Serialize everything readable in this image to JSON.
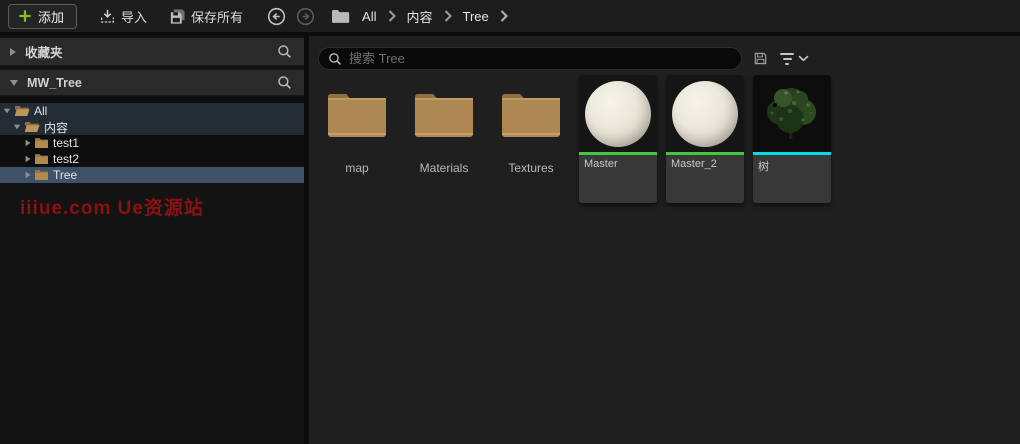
{
  "toolbar": {
    "add_label": "添加",
    "import_label": "导入",
    "save_all_label": "保存所有",
    "breadcrumb": [
      "All",
      "内容",
      "Tree"
    ]
  },
  "left_panel": {
    "favorites_header": "收藏夹",
    "collection_header": "MW_Tree",
    "tree": [
      {
        "label": "All",
        "level": 0,
        "expanded": true,
        "folder": "open",
        "selected": false
      },
      {
        "label": "内容",
        "level": 1,
        "expanded": true,
        "folder": "open",
        "selected": false
      },
      {
        "label": "test1",
        "level": 2,
        "expanded": false,
        "folder": "closed",
        "selected": false
      },
      {
        "label": "test2",
        "level": 2,
        "expanded": false,
        "folder": "closed",
        "selected": false
      },
      {
        "label": "Tree",
        "level": 2,
        "expanded": false,
        "folder": "closed",
        "selected": true
      }
    ],
    "watermark": "iiiue.com Ue资源站"
  },
  "main": {
    "search_placeholder": "搜索 Tree",
    "folders": [
      {
        "name": "map"
      },
      {
        "name": "Materials"
      },
      {
        "name": "Textures"
      }
    ],
    "assets": [
      {
        "name": "Master",
        "type": "material",
        "stripe_color": "#3fc93f"
      },
      {
        "name": "Master_2",
        "type": "material",
        "stripe_color": "#3fc93f"
      },
      {
        "name": "树",
        "type": "static_mesh",
        "stripe_color": "#00dce8"
      }
    ]
  },
  "icons": {
    "add": "plus-icon",
    "import": "import-tray-icon",
    "save_all": "save-all-floppy-icon",
    "back": "circle-arrow-left-icon",
    "forward": "circle-arrow-right-icon",
    "breadcrumb_folder": "folder-icon",
    "breadcrumb_separator": "chevron-right-icon",
    "header_search": "magnifier-icon",
    "searchbar_save": "floppy-icon",
    "filter": "filter-lines-icon",
    "filter_caret": "chevron-down-icon",
    "tree_collapsed": "triangle-right-icon",
    "tree_expanded": "triangle-down-icon"
  },
  "colors": {
    "plus_green": "#84bd29",
    "selected_row_blue": "#3d5269",
    "dim_row_blue": "#232b35",
    "material_stripe": "#3fc93f",
    "static_mesh_stripe": "#00dce8",
    "watermark_red": "#8b1111",
    "toolbar_bg": "#1d1d1d",
    "main_bg": "#1f1f1f",
    "left_bg": "#131313"
  }
}
